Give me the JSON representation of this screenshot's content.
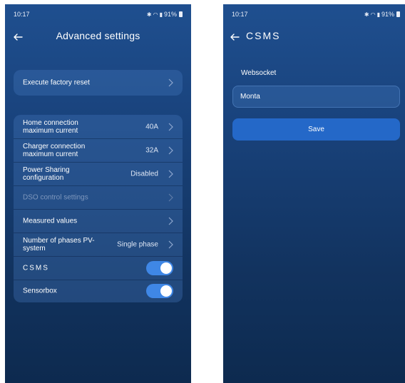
{
  "left_screen": {
    "status": {
      "time": "10:17",
      "battery": "91%"
    },
    "title": "Advanced settings",
    "factory_reset": {
      "label": "Execute factory reset"
    },
    "settings": [
      {
        "label": "Home connection maximum current",
        "value": "40A"
      },
      {
        "label": "Charger connection maximum current",
        "value": "32A"
      },
      {
        "label": "Power Sharing configuration",
        "value": "Disabled"
      },
      {
        "label": "DSO control settings",
        "value": ""
      },
      {
        "label": "Measured values",
        "value": ""
      },
      {
        "label": "Number of phases PV-system",
        "value": "Single phase"
      },
      {
        "label": "CSMS",
        "toggle": true
      },
      {
        "label": "Sensorbox",
        "toggle": true
      }
    ]
  },
  "right_screen": {
    "status": {
      "time": "10:17",
      "battery": "91%"
    },
    "title": "CSMS",
    "websocket_label": "Websocket",
    "websocket_value": "Monta",
    "save_label": "Save"
  },
  "colors": {
    "background_top": "#1f4f8f",
    "background_bottom": "#0d2a4f",
    "accent": "#2468c8",
    "toggle_on": "#3f87e6"
  },
  "icons": [
    "back-arrow-icon",
    "chevron-right-icon",
    "bluetooth-icon",
    "wifi-icon",
    "signal-icon",
    "battery-icon"
  ]
}
